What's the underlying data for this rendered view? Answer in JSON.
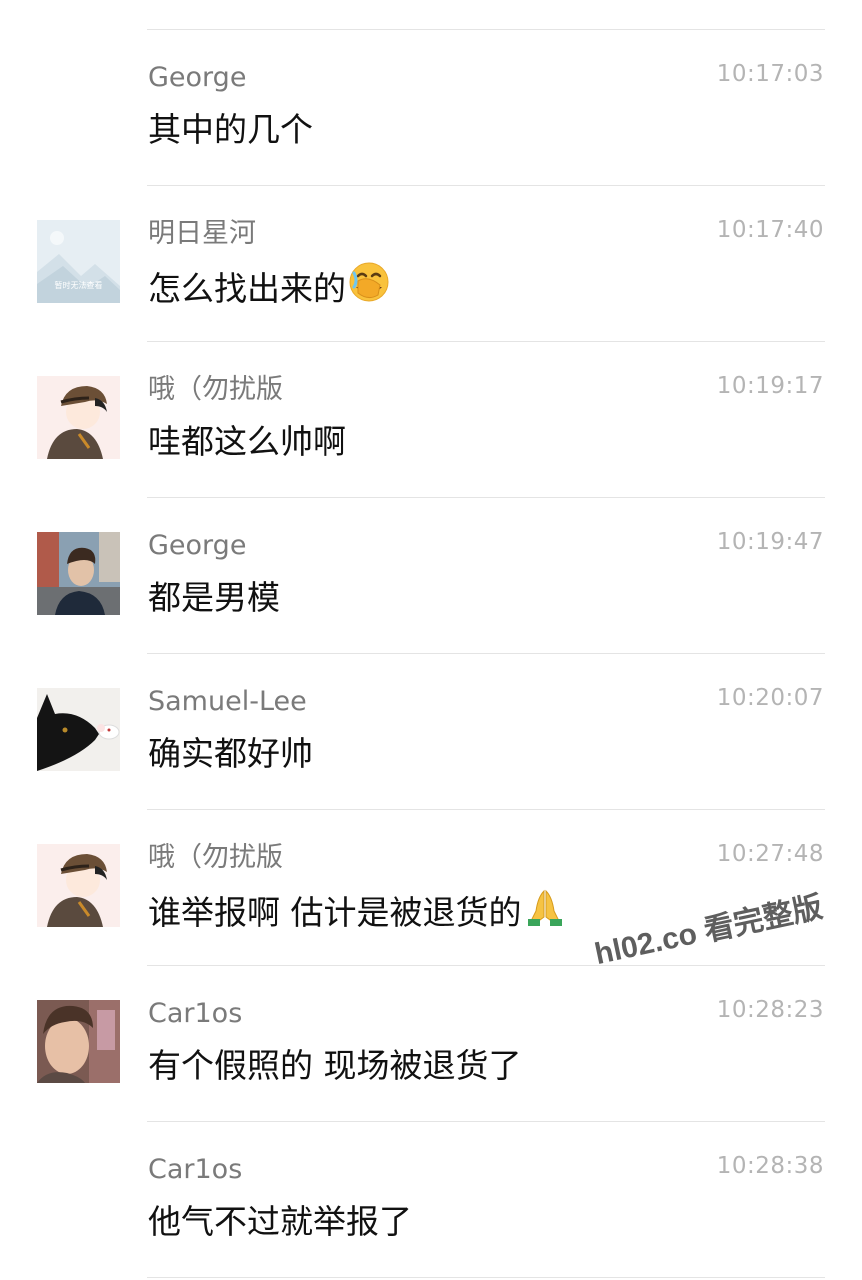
{
  "messages": [
    {
      "name": "George",
      "time": "10:17:03",
      "text": "其中的几个",
      "avatar": "none"
    },
    {
      "name": "明日星河",
      "time": "10:17:40",
      "text": "怎么找出来的",
      "emoji": "face-with-hand-over-mouth-emoji",
      "avatar": "placeholder",
      "avatar_caption": "暂时无法查看"
    },
    {
      "name": "哦（勿扰版",
      "time": "10:19:17",
      "text": "哇都这么帅啊",
      "avatar": "anime-boy"
    },
    {
      "name": "George",
      "time": "10:19:47",
      "text": "都是男模",
      "avatar": "photo-person"
    },
    {
      "name": "Samuel-Lee",
      "time": "10:20:07",
      "text": "确实都好帅",
      "avatar": "black-cat"
    },
    {
      "name": "哦（勿扰版",
      "time": "10:27:48",
      "text": "谁举报啊 估计是被退货的",
      "emoji": "folded-hands-emoji",
      "avatar": "anime-boy"
    },
    {
      "name": "Car1os",
      "time": "10:28:23",
      "text": "有个假照的 现场被退货了",
      "avatar": "photo-man"
    },
    {
      "name": "Car1os",
      "time": "10:28:38",
      "text": "他气不过就举报了",
      "avatar": "none"
    }
  ],
  "watermark": "hl02.co 看完整版",
  "colors": {
    "name": "#7a7a7a",
    "time": "#b4b4b4",
    "text": "#111111",
    "divider": "#e4e4e4"
  }
}
